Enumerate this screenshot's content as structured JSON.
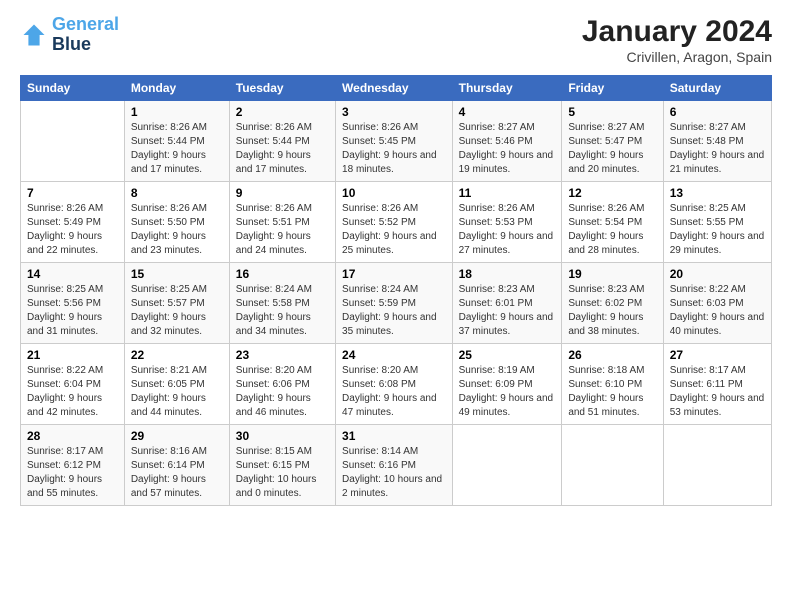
{
  "header": {
    "logo_line1": "General",
    "logo_line2": "Blue",
    "title": "January 2024",
    "subtitle": "Crivillen, Aragon, Spain"
  },
  "columns": [
    "Sunday",
    "Monday",
    "Tuesday",
    "Wednesday",
    "Thursday",
    "Friday",
    "Saturday"
  ],
  "weeks": [
    [
      {
        "day": "",
        "sunrise": "",
        "sunset": "",
        "daylight": ""
      },
      {
        "day": "1",
        "sunrise": "Sunrise: 8:26 AM",
        "sunset": "Sunset: 5:44 PM",
        "daylight": "Daylight: 9 hours and 17 minutes."
      },
      {
        "day": "2",
        "sunrise": "Sunrise: 8:26 AM",
        "sunset": "Sunset: 5:44 PM",
        "daylight": "Daylight: 9 hours and 17 minutes."
      },
      {
        "day": "3",
        "sunrise": "Sunrise: 8:26 AM",
        "sunset": "Sunset: 5:45 PM",
        "daylight": "Daylight: 9 hours and 18 minutes."
      },
      {
        "day": "4",
        "sunrise": "Sunrise: 8:27 AM",
        "sunset": "Sunset: 5:46 PM",
        "daylight": "Daylight: 9 hours and 19 minutes."
      },
      {
        "day": "5",
        "sunrise": "Sunrise: 8:27 AM",
        "sunset": "Sunset: 5:47 PM",
        "daylight": "Daylight: 9 hours and 20 minutes."
      },
      {
        "day": "6",
        "sunrise": "Sunrise: 8:27 AM",
        "sunset": "Sunset: 5:48 PM",
        "daylight": "Daylight: 9 hours and 21 minutes."
      }
    ],
    [
      {
        "day": "7",
        "sunrise": "Sunrise: 8:26 AM",
        "sunset": "Sunset: 5:49 PM",
        "daylight": "Daylight: 9 hours and 22 minutes."
      },
      {
        "day": "8",
        "sunrise": "Sunrise: 8:26 AM",
        "sunset": "Sunset: 5:50 PM",
        "daylight": "Daylight: 9 hours and 23 minutes."
      },
      {
        "day": "9",
        "sunrise": "Sunrise: 8:26 AM",
        "sunset": "Sunset: 5:51 PM",
        "daylight": "Daylight: 9 hours and 24 minutes."
      },
      {
        "day": "10",
        "sunrise": "Sunrise: 8:26 AM",
        "sunset": "Sunset: 5:52 PM",
        "daylight": "Daylight: 9 hours and 25 minutes."
      },
      {
        "day": "11",
        "sunrise": "Sunrise: 8:26 AM",
        "sunset": "Sunset: 5:53 PM",
        "daylight": "Daylight: 9 hours and 27 minutes."
      },
      {
        "day": "12",
        "sunrise": "Sunrise: 8:26 AM",
        "sunset": "Sunset: 5:54 PM",
        "daylight": "Daylight: 9 hours and 28 minutes."
      },
      {
        "day": "13",
        "sunrise": "Sunrise: 8:25 AM",
        "sunset": "Sunset: 5:55 PM",
        "daylight": "Daylight: 9 hours and 29 minutes."
      }
    ],
    [
      {
        "day": "14",
        "sunrise": "Sunrise: 8:25 AM",
        "sunset": "Sunset: 5:56 PM",
        "daylight": "Daylight: 9 hours and 31 minutes."
      },
      {
        "day": "15",
        "sunrise": "Sunrise: 8:25 AM",
        "sunset": "Sunset: 5:57 PM",
        "daylight": "Daylight: 9 hours and 32 minutes."
      },
      {
        "day": "16",
        "sunrise": "Sunrise: 8:24 AM",
        "sunset": "Sunset: 5:58 PM",
        "daylight": "Daylight: 9 hours and 34 minutes."
      },
      {
        "day": "17",
        "sunrise": "Sunrise: 8:24 AM",
        "sunset": "Sunset: 5:59 PM",
        "daylight": "Daylight: 9 hours and 35 minutes."
      },
      {
        "day": "18",
        "sunrise": "Sunrise: 8:23 AM",
        "sunset": "Sunset: 6:01 PM",
        "daylight": "Daylight: 9 hours and 37 minutes."
      },
      {
        "day": "19",
        "sunrise": "Sunrise: 8:23 AM",
        "sunset": "Sunset: 6:02 PM",
        "daylight": "Daylight: 9 hours and 38 minutes."
      },
      {
        "day": "20",
        "sunrise": "Sunrise: 8:22 AM",
        "sunset": "Sunset: 6:03 PM",
        "daylight": "Daylight: 9 hours and 40 minutes."
      }
    ],
    [
      {
        "day": "21",
        "sunrise": "Sunrise: 8:22 AM",
        "sunset": "Sunset: 6:04 PM",
        "daylight": "Daylight: 9 hours and 42 minutes."
      },
      {
        "day": "22",
        "sunrise": "Sunrise: 8:21 AM",
        "sunset": "Sunset: 6:05 PM",
        "daylight": "Daylight: 9 hours and 44 minutes."
      },
      {
        "day": "23",
        "sunrise": "Sunrise: 8:20 AM",
        "sunset": "Sunset: 6:06 PM",
        "daylight": "Daylight: 9 hours and 46 minutes."
      },
      {
        "day": "24",
        "sunrise": "Sunrise: 8:20 AM",
        "sunset": "Sunset: 6:08 PM",
        "daylight": "Daylight: 9 hours and 47 minutes."
      },
      {
        "day": "25",
        "sunrise": "Sunrise: 8:19 AM",
        "sunset": "Sunset: 6:09 PM",
        "daylight": "Daylight: 9 hours and 49 minutes."
      },
      {
        "day": "26",
        "sunrise": "Sunrise: 8:18 AM",
        "sunset": "Sunset: 6:10 PM",
        "daylight": "Daylight: 9 hours and 51 minutes."
      },
      {
        "day": "27",
        "sunrise": "Sunrise: 8:17 AM",
        "sunset": "Sunset: 6:11 PM",
        "daylight": "Daylight: 9 hours and 53 minutes."
      }
    ],
    [
      {
        "day": "28",
        "sunrise": "Sunrise: 8:17 AM",
        "sunset": "Sunset: 6:12 PM",
        "daylight": "Daylight: 9 hours and 55 minutes."
      },
      {
        "day": "29",
        "sunrise": "Sunrise: 8:16 AM",
        "sunset": "Sunset: 6:14 PM",
        "daylight": "Daylight: 9 hours and 57 minutes."
      },
      {
        "day": "30",
        "sunrise": "Sunrise: 8:15 AM",
        "sunset": "Sunset: 6:15 PM",
        "daylight": "Daylight: 10 hours and 0 minutes."
      },
      {
        "day": "31",
        "sunrise": "Sunrise: 8:14 AM",
        "sunset": "Sunset: 6:16 PM",
        "daylight": "Daylight: 10 hours and 2 minutes."
      },
      {
        "day": "",
        "sunrise": "",
        "sunset": "",
        "daylight": ""
      },
      {
        "day": "",
        "sunrise": "",
        "sunset": "",
        "daylight": ""
      },
      {
        "day": "",
        "sunrise": "",
        "sunset": "",
        "daylight": ""
      }
    ]
  ]
}
